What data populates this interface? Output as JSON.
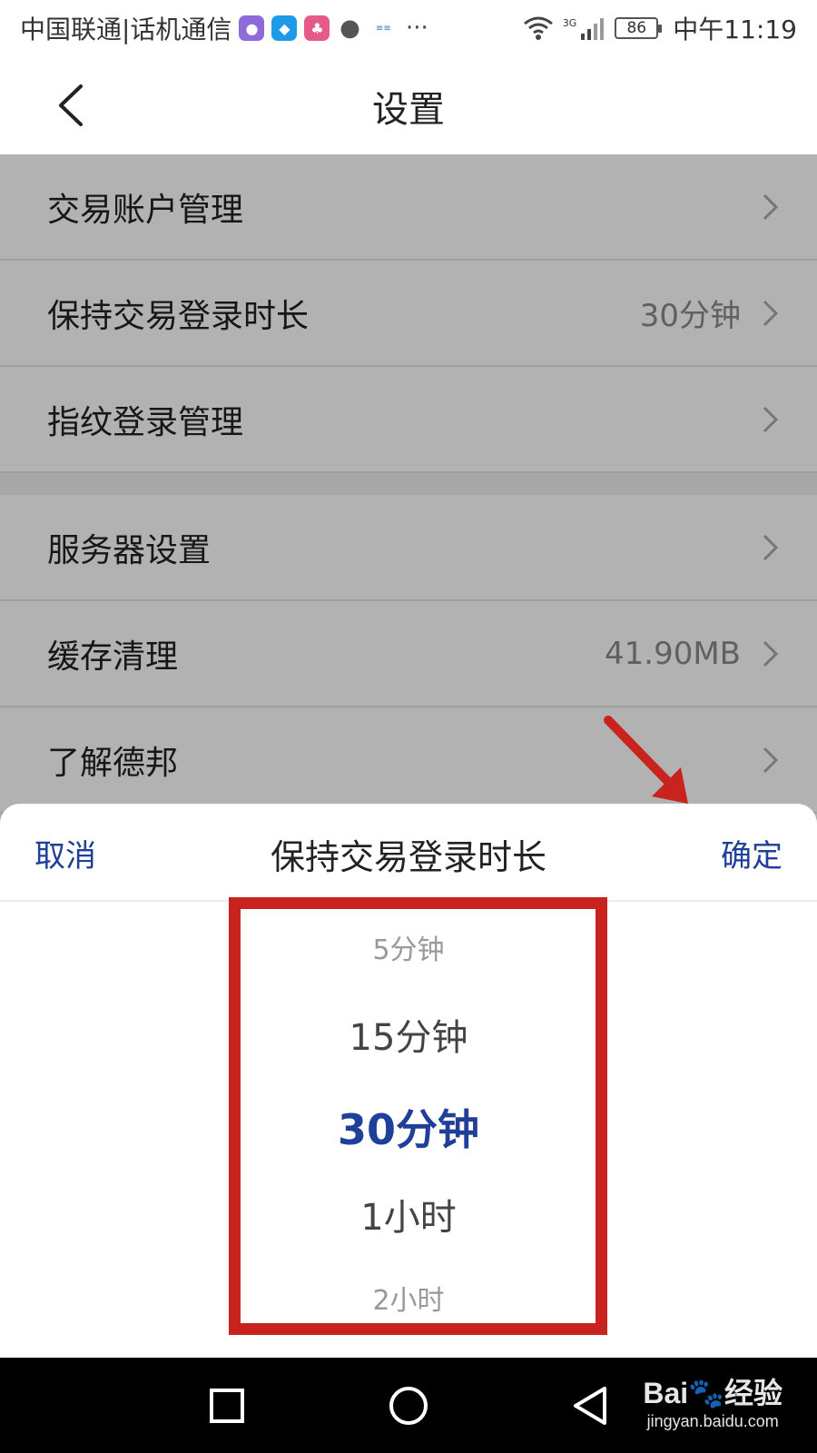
{
  "status_bar": {
    "carrier": "中国联通|话机通信",
    "battery": "86",
    "net_type": "3G",
    "time": "中午11:19",
    "notification_icons": [
      "app-icon",
      "shield-icon",
      "elephant-icon",
      "chat-bubble-icon",
      "news-icon",
      "more-dots-icon"
    ]
  },
  "header": {
    "title": "设置"
  },
  "settings": {
    "group1": [
      {
        "label": "交易账户管理",
        "value": ""
      },
      {
        "label": "保持交易登录时长",
        "value": "30分钟"
      },
      {
        "label": "指纹登录管理",
        "value": ""
      }
    ],
    "group2": [
      {
        "label": "服务器设置",
        "value": ""
      },
      {
        "label": "缓存清理",
        "value": "41.90MB"
      },
      {
        "label": "了解德邦",
        "value": ""
      }
    ]
  },
  "sheet": {
    "cancel_label": "取消",
    "title": "保持交易登录时长",
    "confirm_label": "确定",
    "options": [
      "5分钟",
      "15分钟",
      "30分钟",
      "1小时",
      "2小时"
    ],
    "selected": "30分钟"
  },
  "annotation_colors": {
    "box": "#c8231f",
    "arrow": "#c8231f",
    "accent": "#1f3f99"
  },
  "watermark": {
    "logo": "Bai🐾经验",
    "url": "jingyan.baidu.com"
  }
}
